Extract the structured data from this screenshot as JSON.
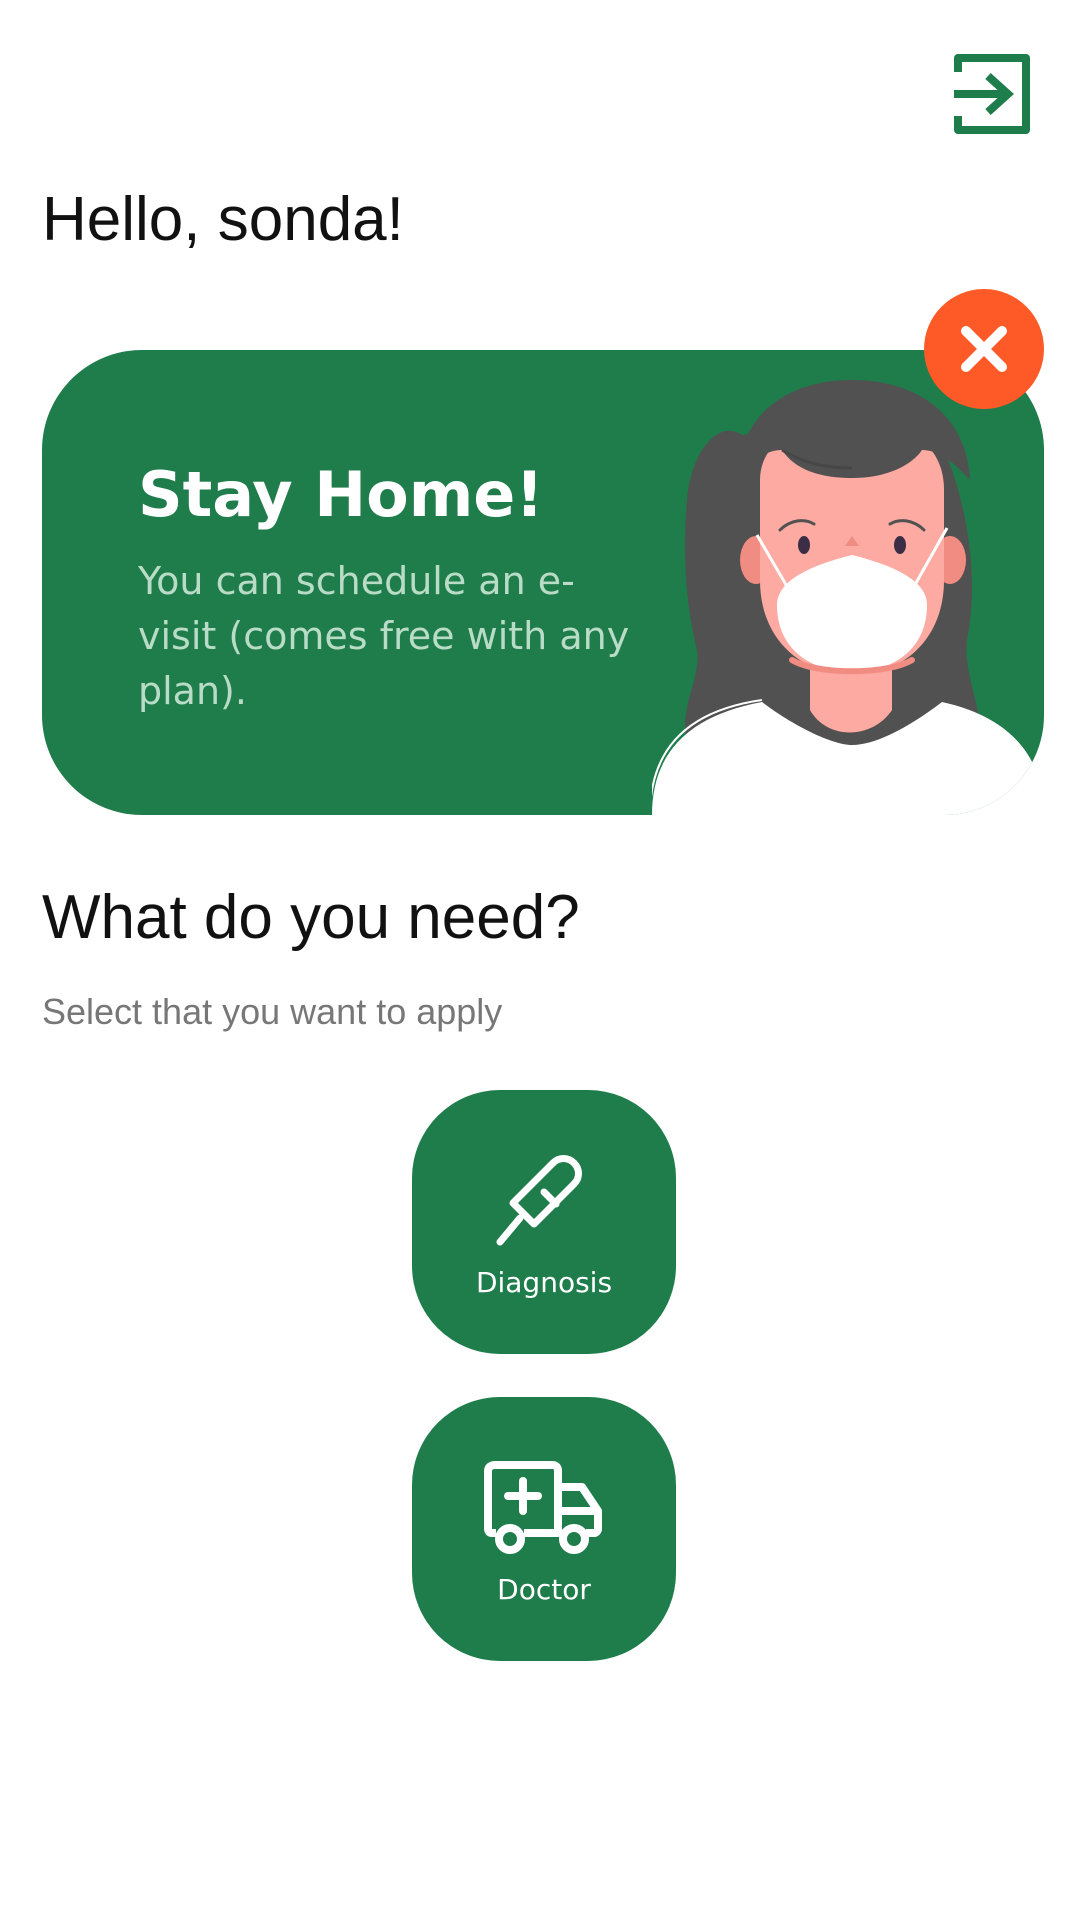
{
  "header": {
    "greeting": "Hello, sonda!",
    "logout_icon": "logout-icon"
  },
  "banner": {
    "title": "Stay Home!",
    "text": "You can schedule an e-visit (comes free with any plan).",
    "close_icon": "close-icon",
    "illustration": "woman-wearing-face-mask"
  },
  "section": {
    "title": "What do you need?",
    "subtitle": "Select that you want to apply"
  },
  "options": [
    {
      "label": "Diagnosis",
      "icon": "thermometer-icon"
    },
    {
      "label": "Doctor",
      "icon": "ambulance-icon"
    }
  ],
  "colors": {
    "primary_green": "#1f7c4b",
    "close_orange": "#fd5a27",
    "banner_text": "#b9dcc7",
    "subtitle_gray": "#777777"
  }
}
